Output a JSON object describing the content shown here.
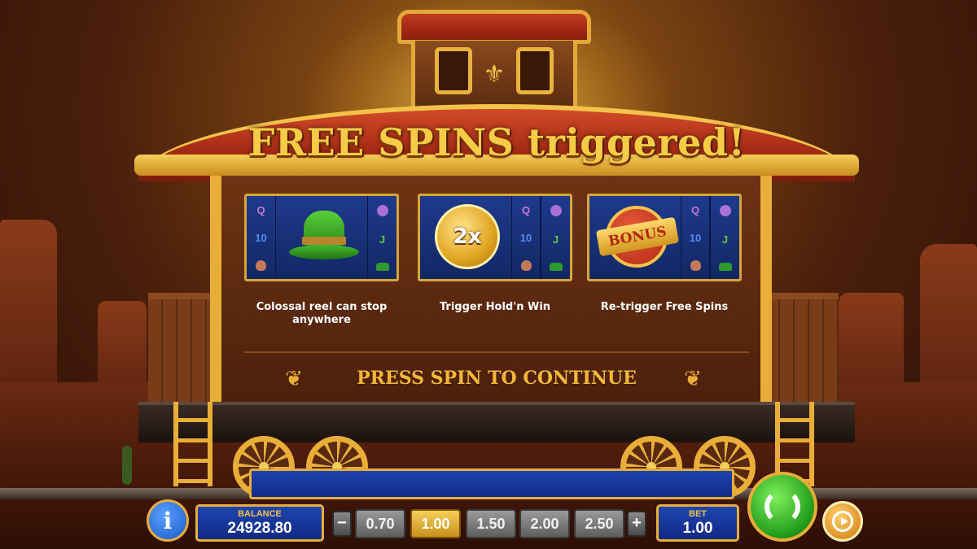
{
  "title": "FREE SPINS triggered!",
  "features": [
    {
      "caption": "Colossal reel can stop anywhere",
      "icon": "green-hat-icon"
    },
    {
      "caption": "Trigger Hold'n Win",
      "icon": "2x-coin-icon",
      "coin_label": "2x"
    },
    {
      "caption": "Re-trigger Free Spins",
      "icon": "bonus-coin-icon",
      "coin_label": "BONUS"
    }
  ],
  "reel_symbols": {
    "left": [
      "Q",
      "10",
      "bag"
    ],
    "right": [
      "flower",
      "J",
      "hat"
    ]
  },
  "prompt": "PRESS SPIN TO CONTINUE",
  "hud": {
    "balance_label": "BALANCE",
    "balance_value": "24928.80",
    "bet_label": "BET",
    "bet_value": "1.00",
    "bet_options": [
      "0.70",
      "1.00",
      "1.50",
      "2.00",
      "2.50"
    ],
    "selected_bet": "1.00",
    "decrease_label": "−",
    "increase_label": "+",
    "info_label": "i"
  },
  "colors": {
    "accent_gold": "#e8ae38",
    "panel_blue": "#1e44b0",
    "title_gold": "#f6cb45",
    "spin_green": "#1f9a1a"
  }
}
